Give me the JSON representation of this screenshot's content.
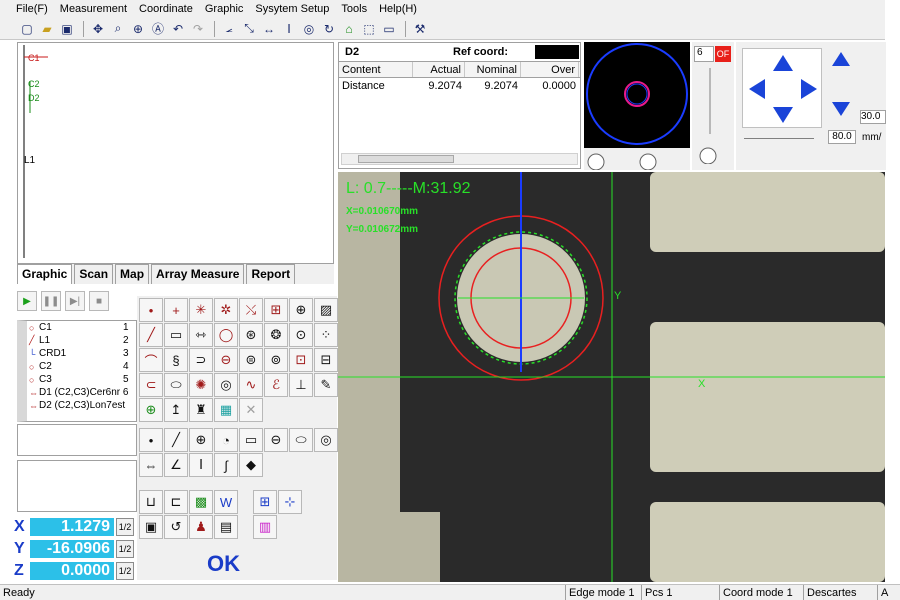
{
  "menu": [
    "File(F)",
    "Measurement",
    "Coordinate",
    "Graphic",
    "Sysytem Setup",
    "Tools",
    "Help(H)"
  ],
  "graphic_labels": {
    "c1": "C1",
    "c2": "C2",
    "d2": "D2",
    "l1": "L1"
  },
  "tabs": [
    "Graphic",
    "Scan",
    "Map",
    "Array Measure",
    "Report"
  ],
  "features": [
    {
      "name": "C1",
      "num": "1"
    },
    {
      "name": "L1",
      "num": "2"
    },
    {
      "name": "CRD1",
      "num": "3"
    },
    {
      "name": "C2",
      "num": "4"
    },
    {
      "name": "C3",
      "num": "5"
    },
    {
      "name": "D1 (C2,C3)Cer6nr 6",
      "num": ""
    },
    {
      "name": "D2 (C2,C3)Lon7est",
      "num": ""
    }
  ],
  "coords": {
    "x": {
      "axis": "X",
      "value": "1.1279",
      "half": "1/2"
    },
    "y": {
      "axis": "Y",
      "value": "-16.0906",
      "half": "1/2"
    },
    "z": {
      "axis": "Z",
      "value": "0.0000",
      "half": "1/2"
    }
  },
  "ok_label": "OK",
  "data_panel": {
    "feature": "D2",
    "ref_label": "Ref coord:",
    "columns": [
      "Content",
      "Actual",
      "Nominal",
      "Over"
    ],
    "row": {
      "content": "Distance",
      "actual": "9.2074",
      "nominal": "9.2074",
      "over": "0.0000"
    }
  },
  "light": {
    "value": "6",
    "of": "OF"
  },
  "jog": {
    "speed": "30.0",
    "step": "80.0",
    "unit": "mm/"
  },
  "camera": {
    "lm_text": "L: 0.7-----M:31.92",
    "x_text": "X=0.010670mm",
    "y_text": "Y=0.010672mm",
    "y_axis": "Y",
    "x_axis": "X"
  },
  "status": {
    "ready": "Ready",
    "edge_mode": "Edge mode 1",
    "pcs": "Pcs 1",
    "coord_mode": "Coord mode 1",
    "descartes": "Descartes",
    "extra": "A"
  },
  "colors": {
    "accent": "#1a3cc8",
    "coord_bg": "#2cc0e8",
    "overlay_green": "#28e028",
    "circle_red": "#e82020"
  }
}
